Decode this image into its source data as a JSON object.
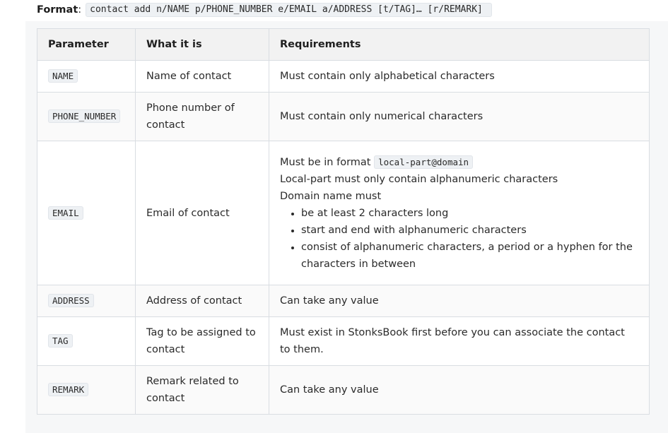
{
  "format": {
    "label": "Format",
    "colon": ":",
    "command": "contact add n/NAME p/PHONE_NUMBER e/EMAIL a/ADDRESS [t/TAG]… [r/REMARK]"
  },
  "table": {
    "headers": [
      "Parameter",
      "What it is",
      "Requirements"
    ],
    "rows": [
      {
        "param": "NAME",
        "what": "Name of contact",
        "requirement": "Must contain only alphabetical characters"
      },
      {
        "param": "PHONE_NUMBER",
        "what": "Phone number of contact",
        "requirement": "Must contain only numerical characters"
      },
      {
        "param": "EMAIL",
        "what": "Email of contact",
        "requirement_format_prefix": "Must be in format",
        "requirement_format_code": "local-part@domain",
        "requirement_localpart": "Local-part must only contain alphanumeric characters",
        "requirement_domain_intro": "Domain name must",
        "requirement_domain_rules": [
          "be at least 2 characters long",
          "start and end with alphanumeric characters",
          "consist of alphanumeric characters, a period or a hyphen for the characters in between"
        ]
      },
      {
        "param": "ADDRESS",
        "what": "Address of contact",
        "requirement": "Can take any value"
      },
      {
        "param": "TAG",
        "what": "Tag to be assigned to contact",
        "requirement": "Must exist in StonksBook first before you can associate the contact to them."
      },
      {
        "param": "REMARK",
        "what": "Remark related to contact",
        "requirement": "Can take any value"
      }
    ]
  }
}
